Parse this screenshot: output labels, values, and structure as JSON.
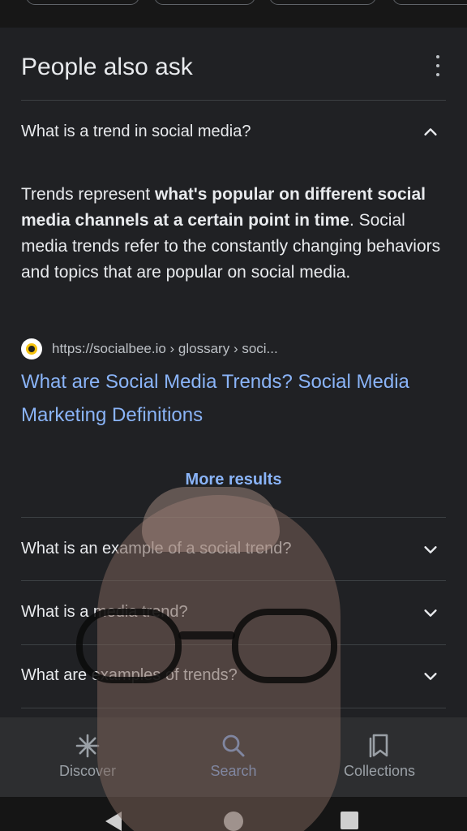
{
  "section": {
    "title": "People also ask"
  },
  "questions": [
    {
      "text": "What is a trend in social media?",
      "expanded": true
    },
    {
      "text": "What is an example of a social trend?",
      "expanded": false
    },
    {
      "text": "What is a media trend?",
      "expanded": false
    },
    {
      "text": "What are examples of trends?",
      "expanded": false
    }
  ],
  "answer": {
    "part1": "Trends represent ",
    "bold": "what's popular on different social media channels at a certain point in time",
    "part2": ". Social media trends refer to the constantly changing behaviors and topics that are popular on social media."
  },
  "source": {
    "url": "https://socialbee.io › glossary › soci...",
    "favicon": "socialbee-favicon-icon"
  },
  "result": {
    "title": "What are Social Media Trends? Social Media Marketing Definitions"
  },
  "more_results_label": "More results",
  "bottom_nav": [
    {
      "label": "Discover",
      "icon": "asterisk-icon",
      "active": false
    },
    {
      "label": "Search",
      "icon": "search-icon",
      "active": true
    },
    {
      "label": "Collections",
      "icon": "bookmark-icon",
      "active": false
    }
  ],
  "colors": {
    "background": "#202124",
    "link": "#8ab4f8",
    "text": "#e8eaed",
    "secondary_text": "#bdc1c6",
    "nav_background": "#2d2e30"
  }
}
